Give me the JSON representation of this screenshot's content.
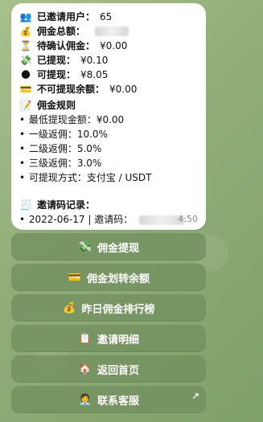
{
  "message": {
    "time": "4:50",
    "invited_users": {
      "emoji": "👥",
      "label": "已邀请用户：",
      "value": "65"
    },
    "total_commission": {
      "emoji": "💰",
      "label": "佣金总额："
    },
    "pending_commission": {
      "emoji": "⏳",
      "label": "待确认佣金：",
      "value": "¥0.00"
    },
    "withdrawn": {
      "emoji": "💸",
      "label": "已提现：",
      "value": "¥0.10"
    },
    "withdrawable": {
      "emoji": "🌑",
      "label": "可提现：",
      "value": "¥8.05"
    },
    "non_withdrawable_balance": {
      "emoji": "💳",
      "label": "不可提现余额：",
      "value": "¥0.00"
    },
    "rules_title": {
      "emoji": "📝",
      "label": "佣金规则"
    },
    "rules": [
      "最低提现金额：¥0.00",
      "一级返佣：10.0%",
      "二级返佣：5.0%",
      "三级返佣：3.0%",
      "可提现方式：支付宝 / USDT"
    ],
    "invite_record_title": {
      "emoji": "🧾",
      "label": "邀请码记录："
    },
    "invite_record_line": "2022-06-17 | 邀请码："
  },
  "buttons": [
    {
      "emoji": "💸",
      "label": "佣金提现"
    },
    {
      "emoji": "💳",
      "label": "佣金划转余额"
    },
    {
      "emoji": "💰",
      "label": "昨日佣金排行榜"
    },
    {
      "emoji": "📋",
      "label": "邀请明细"
    },
    {
      "emoji": "🏠",
      "label": "返回首页"
    },
    {
      "emoji": "🧑‍💼",
      "label": "联系客服",
      "corner_icon": "↗"
    }
  ]
}
